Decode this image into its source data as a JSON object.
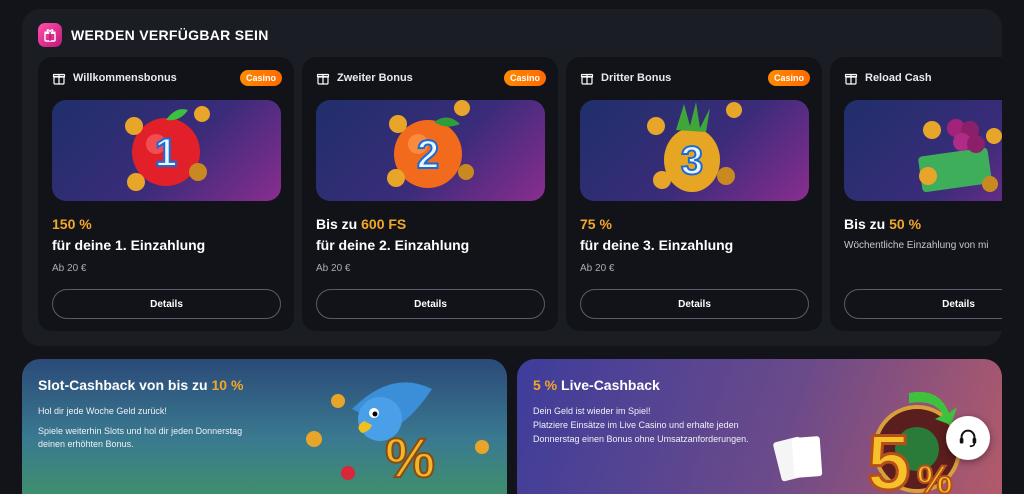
{
  "section": {
    "title": "WERDEN VERFÜGBAR SEIN"
  },
  "cards": [
    {
      "name": "Willkommensbonus",
      "tag": "Casino",
      "amount": "150 %",
      "description": "für deine 1. Einzahlung",
      "min": "Ab 20 €",
      "button": "Details",
      "art": "apple-1"
    },
    {
      "name": "Zweiter Bonus",
      "tag": "Casino",
      "amount_prefix": "Bis zu ",
      "amount": "600 FS",
      "description": "für deine 2. Einzahlung",
      "min": "Ab 20 €",
      "button": "Details",
      "art": "orange-2"
    },
    {
      "name": "Dritter Bonus",
      "tag": "Casino",
      "amount": "75 %",
      "description": "für deine 3. Einzahlung",
      "min": "Ab 20 €",
      "button": "Details",
      "art": "pineapple-3"
    },
    {
      "name": "Reload Cash",
      "amount_prefix": "Bis zu ",
      "amount": "50 %",
      "description": "Wöchentliche Einzahlung von mi",
      "button": "Details",
      "art": "grapes-cash"
    }
  ],
  "promos": [
    {
      "title_prefix": "Slot-Cashback von bis zu ",
      "title_value": "10 %",
      "line1": "Hol dir jede Woche Geld zurück!",
      "line2": "Spiele weiterhin Slots und hol dir jeden Donnerstag",
      "line3": "deinen erhöhten Bonus."
    },
    {
      "title_value": "5 %",
      "title_suffix": " Live-Cashback",
      "line1": "Dein Geld ist wieder im Spiel!",
      "line2": "Platziere Einsätze im Live Casino und erhalte jeden",
      "line3": "Donnerstag einen Bonus ohne Umsatzanforderungen."
    }
  ],
  "colors": {
    "accent": "#f3a72a",
    "tag": "#ff7a00",
    "pink": "#e0338f"
  }
}
